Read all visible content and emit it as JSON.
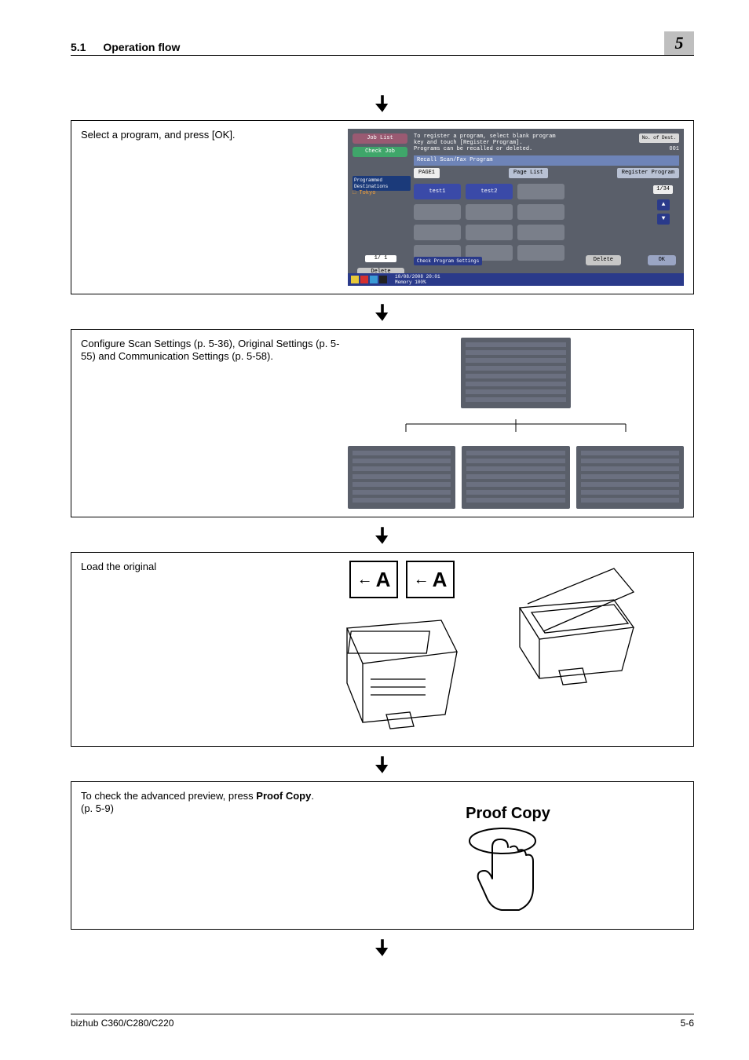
{
  "header": {
    "section_number": "5.1",
    "section_title": "Operation flow",
    "chapter": "5"
  },
  "step1": {
    "text": "Select a program, and press [OK].",
    "screen": {
      "job_list": "Job List",
      "check_job": "Check Job",
      "prog_dest": "Programmed Destinations",
      "tokyo": "Tokyo",
      "page_counter_side": "1/  1",
      "delete_side": "Delete",
      "msg_line1": "To register a program, select blank program",
      "msg_line2": "key and touch [Register Program].",
      "msg_line3": "Programs can be recalled or deleted.",
      "no_off": "No. of Dest.",
      "code": "001",
      "bar": "Recall Scan/Fax Program",
      "page1": "PAGE1",
      "page_list": "Page List",
      "register": "Register Program",
      "test1": "test1",
      "test2": "test2",
      "counter": "1/34",
      "check": "Check Program Settings",
      "delete": "Delete",
      "ok": "OK",
      "timestamp": "10/08/2008  20:01",
      "memory": "Memory      100%"
    }
  },
  "step2": {
    "text": "Configure Scan Settings (p. 5-36), Original Settings (p. 5-55) and Communication Settings (p. 5-58)."
  },
  "step3": {
    "text": "Load the original",
    "doc_letter": "A"
  },
  "step4": {
    "text_pre": "To check the advanced preview, press ",
    "text_bold": "Proof Copy",
    "text_post": ".(p. 5-9)",
    "button_label": "Proof Copy"
  },
  "footer": {
    "model": "bizhub C360/C280/C220",
    "page": "5-6"
  }
}
